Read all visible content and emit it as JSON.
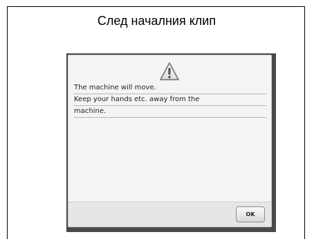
{
  "caption": "След началния клип",
  "dialog": {
    "icon": "warning-icon",
    "lines": [
      "The machine will move.",
      "Keep your hands etc. away from the",
      "machine."
    ],
    "ok_label": "OK"
  },
  "colors": {
    "screen_bezel": "#4a4a4a",
    "dialog_background": "#f4f4f4",
    "footer_background": "#e6e6e6"
  }
}
